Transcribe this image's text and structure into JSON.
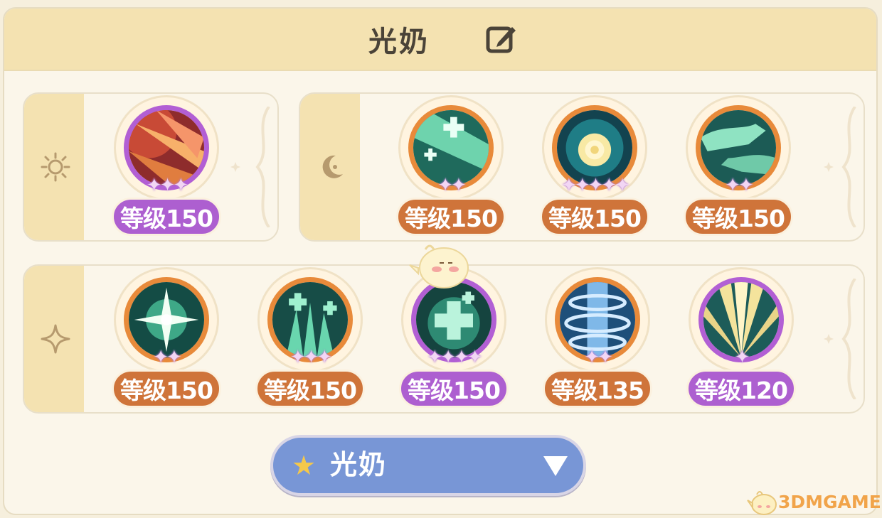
{
  "header": {
    "title": "光奶",
    "edit_icon": "edit-icon"
  },
  "groups": [
    {
      "icon": "sun-icon",
      "skills": [
        {
          "level": "等级150",
          "stars": "✦✦✦",
          "badge_color": "purple",
          "art": "crimson-slash"
        }
      ]
    },
    {
      "icon": "moon-icon",
      "skills": [
        {
          "level": "等级150",
          "stars": "✦✦",
          "badge_color": "orange",
          "art": "green-cross-beam"
        },
        {
          "level": "等级150",
          "stars": "✦✦✦✦✦",
          "badge_color": "orange",
          "art": "golden-swirl"
        },
        {
          "level": "等级150",
          "stars": "✦✦",
          "badge_color": "orange",
          "art": "healing-hands"
        }
      ]
    },
    {
      "icon": "sparkle-icon",
      "skills": [
        {
          "level": "等级150",
          "stars": "✦✦",
          "badge_color": "orange",
          "art": "green-starburst"
        },
        {
          "level": "等级150",
          "stars": "✦✦✦",
          "badge_color": "orange",
          "art": "green-crosses"
        },
        {
          "level": "等级150",
          "stars": "✦✦✦✦",
          "badge_color": "purple",
          "art": "big-green-cross"
        },
        {
          "level": "等级135",
          "stars": "✦✦",
          "badge_color": "orange",
          "art": "blue-rings"
        },
        {
          "level": "等级120",
          "stars": "✦",
          "badge_color": "purple",
          "art": "golden-rays"
        }
      ]
    }
  ],
  "selector": {
    "label": "光奶",
    "star_icon": "star-icon",
    "arrow_icon": "dropdown-arrow-icon"
  },
  "watermark": {
    "text": "3DMGAME"
  },
  "colors": {
    "header_bg": "#f4e2b1",
    "badge_orange": "#cf743a",
    "badge_purple": "#ad5fd0",
    "selector_bg": "#7896d6"
  }
}
